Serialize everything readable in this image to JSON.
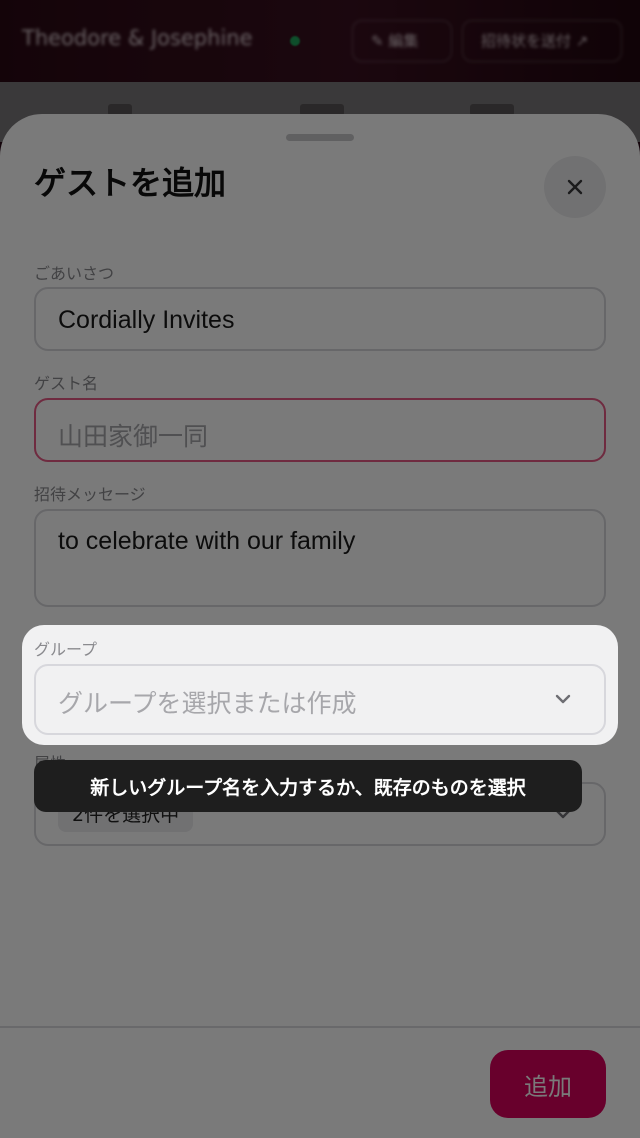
{
  "background": {
    "title": "Theodore & Josephine",
    "status_color": "#1fa35a",
    "edit_label": "✎ 編集",
    "share_label": "招待状を送付 ↗"
  },
  "sheet": {
    "title": "ゲストを追加",
    "close_icon": "close-icon",
    "fields": {
      "greeting": {
        "label": "ごあいさつ",
        "value": "Cordially Invites"
      },
      "guest_name": {
        "label": "ゲスト名",
        "placeholder": "山田家御一同"
      },
      "message": {
        "label": "招待メッセージ",
        "value": "to celebrate with our family"
      },
      "group": {
        "label": "グループ",
        "placeholder": "グループを選択または作成",
        "icon": "chevron-down-icon"
      },
      "attributes": {
        "label": "属性",
        "selected": "2件を選択中",
        "icon": "chevron-down-icon"
      }
    },
    "add_button": "追加",
    "accent_color": "#d9005c",
    "error_color": "#e85b86"
  },
  "tooltip": {
    "text": "新しいグループ名を入力するか、既存のものを選択"
  }
}
